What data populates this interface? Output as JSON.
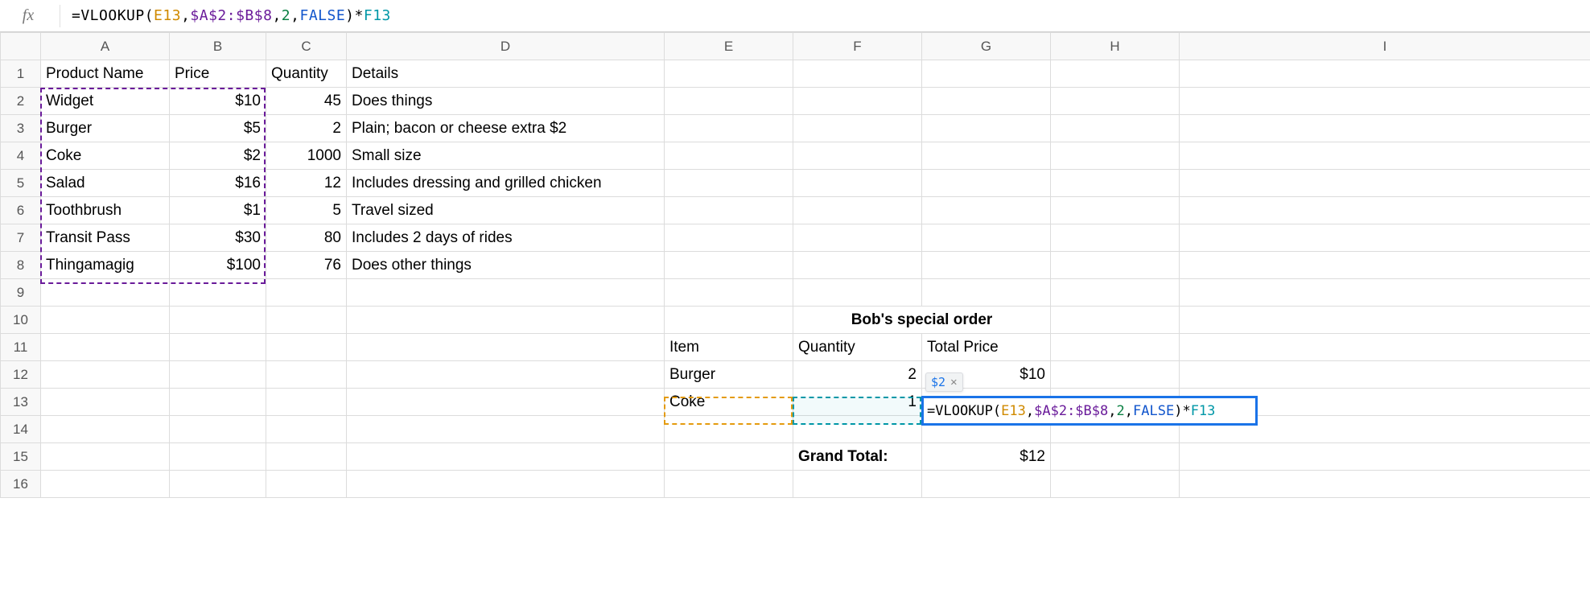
{
  "formula_bar": {
    "fx": "fx",
    "tokens": {
      "eq": "=",
      "fn": "VLOOKUP",
      "lp": "(",
      "arg1": "E13",
      "c1": ",",
      "arg2": "$A$2:$B$8",
      "c2": ",",
      "arg3": "2",
      "c3": ",",
      "arg4": "FALSE",
      "rp": ")",
      "mul": "*",
      "arg5": "F13"
    }
  },
  "columns": [
    "A",
    "B",
    "C",
    "D",
    "E",
    "F",
    "G",
    "H",
    "I"
  ],
  "row_numbers": [
    "1",
    "2",
    "3",
    "4",
    "5",
    "6",
    "7",
    "8",
    "9",
    "10",
    "11",
    "12",
    "13",
    "14",
    "15",
    "16"
  ],
  "cells": {
    "A1": "Product Name",
    "B1": "Price",
    "C1": "Quantity",
    "D1": "Details",
    "A2": "Widget",
    "B2": "$10",
    "C2": "45",
    "D2": "Does things",
    "A3": "Burger",
    "B3": "$5",
    "C3": "2",
    "D3": "Plain; bacon or cheese extra $2",
    "A4": "Coke",
    "B4": "$2",
    "C4": "1000",
    "D4": "Small size",
    "A5": "Salad",
    "B5": "$16",
    "C5": "12",
    "D5": "Includes dressing and grilled chicken",
    "A6": "Toothbrush",
    "B6": "$1",
    "C6": "5",
    "D6": "Travel sized",
    "A7": "Transit Pass",
    "B7": "$30",
    "C7": "80",
    "D7": "Includes 2 days of rides",
    "A8": "Thingamagig",
    "B8": "$100",
    "C8": "76",
    "D8": "Does other things",
    "F10": "Bob's special order",
    "E11": "Item",
    "F11": "Quantity",
    "G11": "Total Price",
    "E12": "Burger",
    "F12": "2",
    "G12": "$10",
    "E13": "Coke",
    "F13": "1",
    "F15": "Grand Total:",
    "G15": "$12"
  },
  "hint": {
    "value": "$2"
  },
  "active": {
    "col": "G",
    "row": "13"
  }
}
